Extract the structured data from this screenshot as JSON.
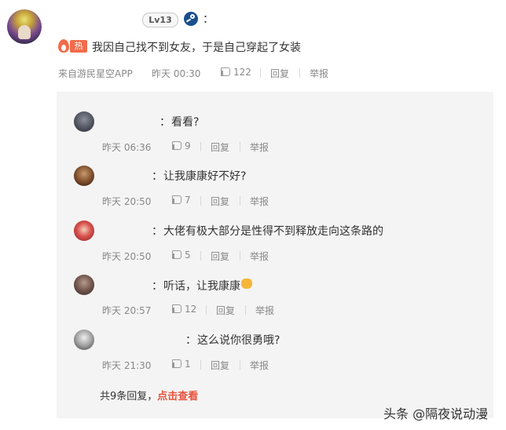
{
  "post": {
    "level": "Lv13",
    "colon": "：",
    "hot_label": "热",
    "text": "我因自己找不到女友，于是自己穿起了女装",
    "source": "来自游民星空APP",
    "time": "昨天 00:30",
    "likes": "122",
    "reply_label": "回复",
    "report_label": "举报"
  },
  "replies": [
    {
      "colon": "：",
      "text": "看看?",
      "time": "昨天 06:36",
      "likes": "9",
      "reply_label": "回复",
      "report_label": "举报"
    },
    {
      "colon": "：",
      "text": "让我康康好不好?",
      "time": "昨天 20:50",
      "likes": "7",
      "reply_label": "回复",
      "report_label": "举报"
    },
    {
      "colon": "：",
      "text": "大佬有极大部分是性得不到释放走向这条路的",
      "time": "昨天 20:50",
      "likes": "5",
      "reply_label": "回复",
      "report_label": "举报"
    },
    {
      "colon": "：",
      "text": "听话，让我康康",
      "emoji": "fist-emoji",
      "time": "昨天 20:57",
      "likes": "12",
      "reply_label": "回复",
      "report_label": "举报"
    },
    {
      "colon": "：",
      "text": "这么说你很勇哦?",
      "time": "昨天 21:30",
      "likes": "1",
      "reply_label": "回复",
      "report_label": "举报"
    }
  ],
  "footer": {
    "total": "共9条回复，",
    "view_link": "点击查看"
  },
  "watermark": "头条 @隔夜说动漫",
  "colors": {
    "hot": "#f26b4a",
    "link": "#e8533d",
    "reply_bg": "#f4f4f4",
    "meta_text": "#888888"
  }
}
